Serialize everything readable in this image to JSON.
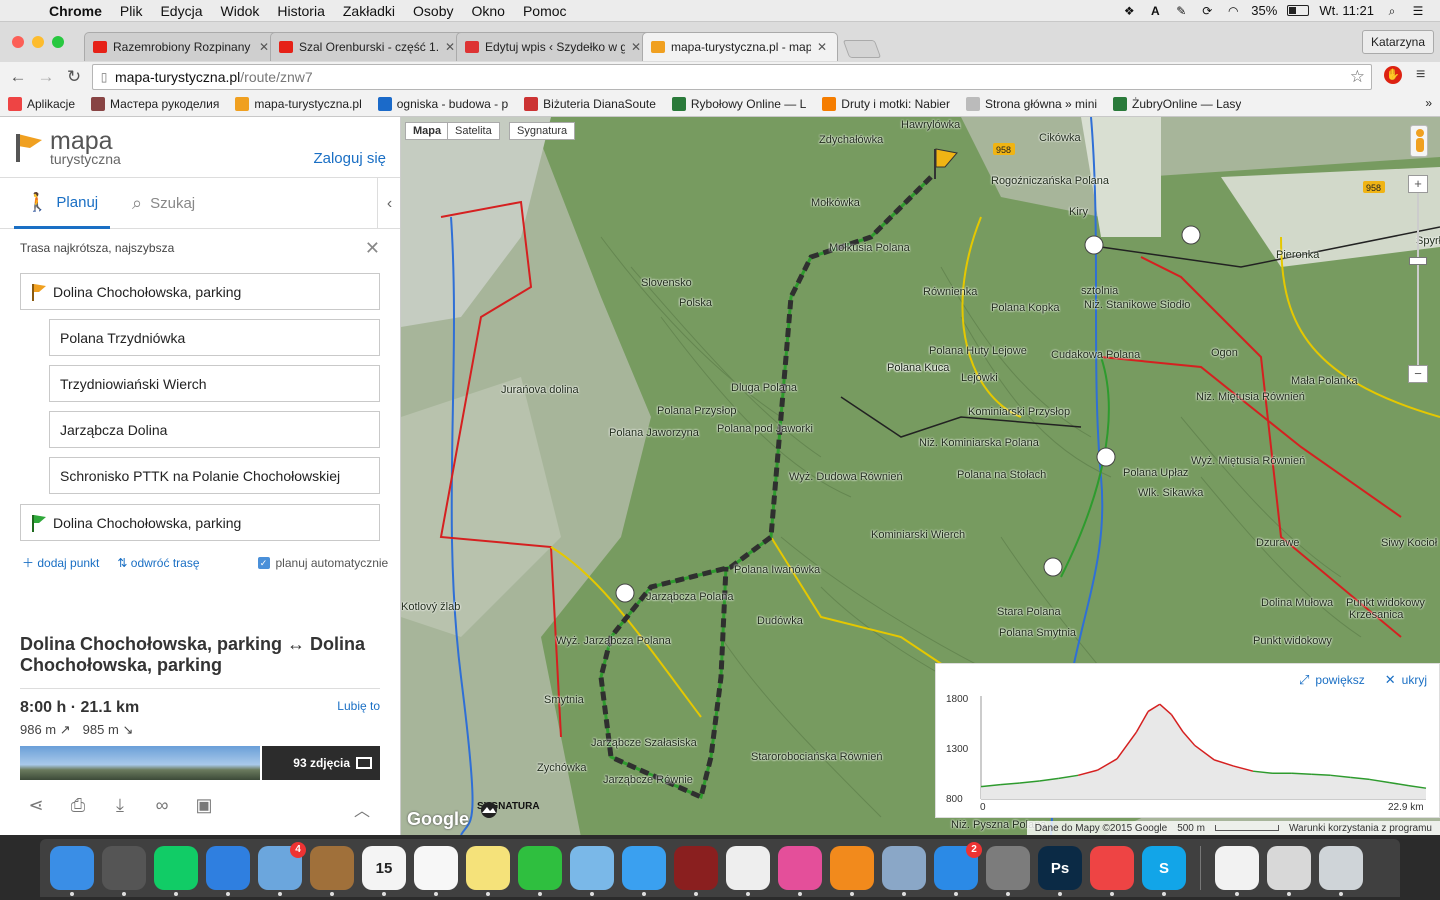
{
  "menubar": {
    "app": "Chrome",
    "items": [
      "Plik",
      "Edycja",
      "Widok",
      "Historia",
      "Zakładki",
      "Osoby",
      "Okno",
      "Pomoc"
    ],
    "battery": "35%",
    "battery_level": 0.35,
    "clock": "Wt. 11:21",
    "tray_icons": [
      "dropbox-icon",
      "adobe-icon",
      "evernote-icon",
      "sync-icon",
      "wifi-icon",
      "battery-icon",
      "search-icon",
      "list-icon"
    ]
  },
  "chrome": {
    "tabs": [
      {
        "title": "Razemrobiony Rozpinany - c",
        "favicon_color": "#e62117"
      },
      {
        "title": "Szal Orenburski - część 1. -",
        "favicon_color": "#e62117"
      },
      {
        "title": "Edytuj wpis ‹ Szydełko w gó",
        "favicon_color": "#d33"
      },
      {
        "title": "mapa-turystyczna.pl - mapa",
        "favicon_color": "#f0a020",
        "active": true
      }
    ],
    "profile": "Katarzyna",
    "url_host": "mapa-turystyczna.pl",
    "url_path": "/route/znw7",
    "bookmarks": [
      {
        "label": "Aplikacje",
        "color": "#e44"
      },
      {
        "label": "Мастера рукоделия",
        "color": "#844"
      },
      {
        "label": "mapa-turystyczna.pl",
        "color": "#f0a020"
      },
      {
        "label": "ogniska - budowa - p",
        "color": "#1b6ac9"
      },
      {
        "label": "Biżuteria DianaSoute",
        "color": "#c33"
      },
      {
        "label": "Rybołowy Online — L",
        "color": "#2a7a3a"
      },
      {
        "label": "Druty i motki: Nabier",
        "color": "#f57d00"
      },
      {
        "label": "Strona główna » mini",
        "color": "#bbb"
      },
      {
        "label": "ŻubryOnline — Lasy",
        "color": "#2a7a3a"
      }
    ]
  },
  "panel": {
    "logo_line1": "mapa",
    "logo_line2": "turystyczna",
    "login": "Zaloguj się",
    "tab_plan": "Planuj",
    "tab_search": "Szukaj",
    "route_type": "Trasa najkrótsza, najszybsza",
    "waypoints": [
      {
        "label": "Dolina Chochołowska, parking",
        "flag": "start"
      },
      {
        "label": "Polana Trzydniówka"
      },
      {
        "label": "Trzydniowiański Wierch"
      },
      {
        "label": "Jarząbcza Dolina"
      },
      {
        "label": "Schronisko PTTK na Polanie Chochołowskiej"
      },
      {
        "label": "Dolina Chochołowska, parking",
        "flag": "end"
      }
    ],
    "add_point": "dodaj punkt",
    "reverse": "odwróć trasę",
    "auto_plan": "planuj automatycznie",
    "route_title": "Dolina Chochołowska, parking ↔ Dolina Chochołowska, parking",
    "summary": "8:00 h · 21.1 km",
    "like": "Lubię to",
    "ascent": "986 m",
    "descent": "985 m",
    "photos": "93 zdjęcia"
  },
  "map": {
    "types": [
      "Mapa",
      "Satelita",
      "Sygnatura"
    ],
    "labels": [
      "Hawrylówka",
      "Zdychałówka",
      "Cikówka",
      "Rogoźniczańska Polana",
      "Kiry",
      "Mołkówka",
      "Spyrłówka",
      "Pieronka",
      "Polana Kopka",
      "Równienka",
      "Mołkusia Polana",
      "Slovensko",
      "Polska",
      "sztolnia",
      "Niż. Stanikowe Siodło",
      "Cudakowa Polana",
      "Ogon",
      "Polana Huty Lejowe",
      "Lejówki",
      "Mała Polanka",
      "Niż. Miętusia Równień",
      "Polana Kuca",
      "Polana Kuca",
      "Dluga Polana",
      "Jurańova dolina",
      "Polana Przysłop",
      "Polana pod Jaworki",
      "Polana Jaworzyna",
      "Kominiarski Przysłop",
      "Niż. Kominiarska Polana",
      "Polana na Stołach",
      "Polana Upłaz",
      "Wyż. Miętusia Równień",
      "Wyż. Dudowa Równień",
      "Wlk. Sikawka",
      "Kominiarski Wierch",
      "Dzurawe",
      "Siwy Kocioł",
      "Polana Iwanówka",
      "Jarząbcza Polana",
      "Kotlový žlab",
      "Wyż. Jarząbcza Polana",
      "Dudówka",
      "Stara Polana",
      "Polana Smytnia",
      "Dolina Mułowa",
      "Punkt widokowy",
      "Krzesanica",
      "Punkt widokowy",
      "Smytnia",
      "Jarząbcze Szałasiska",
      "Zychówka",
      "Jarząbcze Równie",
      "Starorobociańska Równień",
      "Niż. Pyszna Polana",
      "958",
      "958"
    ],
    "attribution": "Dane do Mapy ©2015 Google",
    "scale": "500 m",
    "terms": "Warunki korzystania z programu",
    "brand": "Google",
    "sygnatura": "SYGNATURA"
  },
  "elevation": {
    "enlarge": "powiększ",
    "hide": "ukryj",
    "y_labels": [
      "1800",
      "1300",
      "800"
    ],
    "x_start": "0",
    "x_end": "22.9 km"
  },
  "chart_data": {
    "type": "area",
    "xlabel": "",
    "ylabel": "",
    "x_unit": "km",
    "xlim": [
      0,
      22.9
    ],
    "ylim": [
      800,
      1800
    ],
    "grid": false,
    "x": [
      0,
      1,
      2,
      3,
      4,
      5,
      6,
      7,
      8,
      8.6,
      9.2,
      9.8,
      10.4,
      11,
      12,
      13,
      14,
      15,
      16,
      17,
      18,
      19,
      20,
      21,
      22,
      22.9
    ],
    "values": [
      920,
      940,
      955,
      975,
      1000,
      1030,
      1080,
      1190,
      1450,
      1650,
      1720,
      1620,
      1450,
      1320,
      1180,
      1120,
      1070,
      1050,
      1050,
      1040,
      1030,
      1010,
      990,
      960,
      930,
      905
    ],
    "segment_colors": {
      "low": "#2e9b2e",
      "high": "#d52020"
    }
  },
  "dock": {
    "apps": [
      {
        "name": "finder-icon",
        "color": "#3a8ee6"
      },
      {
        "name": "launchpad-icon",
        "color": "#555"
      },
      {
        "name": "mission-control-icon",
        "color": "#1c6"
      },
      {
        "name": "safari-icon",
        "color": "#2f7fe0"
      },
      {
        "name": "mail-icon",
        "color": "#6ba6dd",
        "badge": "4"
      },
      {
        "name": "contacts-icon",
        "color": "#a0703a"
      },
      {
        "name": "calendar-icon",
        "color": "#f4f4f4",
        "text": "15"
      },
      {
        "name": "reminders-icon",
        "color": "#f7f7f7"
      },
      {
        "name": "notes-icon",
        "color": "#f5e27a"
      },
      {
        "name": "facetime-icon",
        "color": "#2fbf3f"
      },
      {
        "name": "maps-icon",
        "color": "#7ab8e8"
      },
      {
        "name": "messages-icon",
        "color": "#3aa0f0"
      },
      {
        "name": "photobooth-icon",
        "color": "#8a1f1f"
      },
      {
        "name": "photos-icon",
        "color": "#eee"
      },
      {
        "name": "itunes-icon",
        "color": "#e44f9a"
      },
      {
        "name": "ibooks-icon",
        "color": "#f28a1c"
      },
      {
        "name": "preview-icon",
        "color": "#8aa7c7"
      },
      {
        "name": "appstore-icon",
        "color": "#2b8ae6",
        "badge": "2"
      },
      {
        "name": "system-preferences-icon",
        "color": "#7c7c7c"
      },
      {
        "name": "photoshop-icon",
        "color": "#0b2a45",
        "text": "Ps"
      },
      {
        "name": "chrome-icon",
        "color": "#e44"
      },
      {
        "name": "skype-icon",
        "color": "#12a5e8",
        "text": "S"
      }
    ],
    "right": [
      {
        "name": "document-icon",
        "color": "#f2f2f2"
      },
      {
        "name": "scanner-icon",
        "color": "#d8d8d8"
      },
      {
        "name": "trash-icon",
        "color": "#cfd4d8"
      }
    ]
  }
}
